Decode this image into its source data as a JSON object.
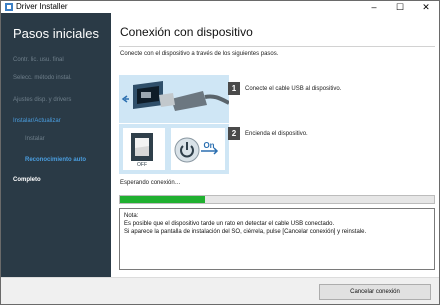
{
  "window": {
    "title": "Driver Installer"
  },
  "titlebar": {
    "minimize": "–",
    "maximize": "☐",
    "close": "✕"
  },
  "sidebar": {
    "heading": "Pasos iniciales",
    "items": [
      {
        "label": "Contr. lic. usu. final"
      },
      {
        "label": "Selecc. método instal."
      },
      {
        "label": "Ajustes disp. y drivers"
      },
      {
        "label": "Instalar/Actualizar"
      },
      {
        "label": "Instalar"
      },
      {
        "label": "Reconocimiento auto"
      },
      {
        "label": "Completo"
      }
    ]
  },
  "main": {
    "heading": "Conexión con dispositivo",
    "intro": "Conecte con el dispositivo a través de los siguientes pasos.",
    "steps": [
      {
        "number": "1",
        "text": "Conecte el cable USB al dispositivo."
      },
      {
        "number": "2",
        "text": "Encienda el dispositivo."
      }
    ],
    "illustration": {
      "off_label": "OFF",
      "on_label": "On"
    },
    "status": "Esperando conexión…",
    "progress": 0.27,
    "note": {
      "lines": [
        "Nota:",
        "Es posible que el dispositivo tarde un rato en detectar el cable USB conectado.",
        "Si aparece la pantalla de instalación del SO, ciérrela, pulse [Cancelar conexión] y reinstale."
      ]
    }
  },
  "footer": {
    "cancel_label": "Cancelar conexión"
  },
  "colors": {
    "sidebar_bg": "#2a3a46",
    "accent": "#4a9ee0",
    "progress": "#20b030"
  }
}
